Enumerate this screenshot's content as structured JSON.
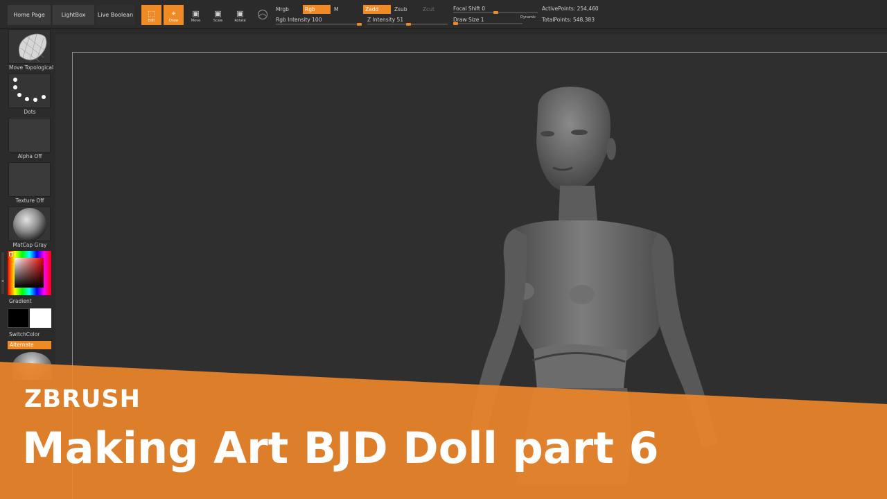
{
  "nav": {
    "home_page": "Home Page",
    "lightbox": "LightBox",
    "live_boolean": "Live Boolean"
  },
  "tools": {
    "edit": "Edit",
    "draw": "Draw",
    "move": "Move",
    "scale": "Scale",
    "rotate": "Rotate"
  },
  "modes": {
    "mrgb": "Mrgb",
    "rgb": "Rgb",
    "m": "M",
    "zadd": "Zadd",
    "zsub": "Zsub",
    "zcut": "Zcut"
  },
  "params": {
    "rgb_intensity": "Rgb Intensity 100",
    "z_intensity": "Z Intensity 51",
    "focal_shift": "Focal Shift 0",
    "draw_size": "Draw Size 1",
    "dynamic": "Dynamic",
    "rgb_intensity_value": 100,
    "z_intensity_value": 51,
    "focal_shift_value": 0,
    "draw_size_value": 1
  },
  "stats": {
    "active_points": "ActivePoints: 254,460",
    "total_points": "TotalPoints: 548,383"
  },
  "shelf": {
    "brush": "Move Topological",
    "stroke": "Dots",
    "alpha": "Alpha Off",
    "texture": "Texture Off",
    "material": "MatCap Gray",
    "gradient": "Gradient",
    "switch_color": "SwitchColor",
    "alternate": "Alternate"
  },
  "banner": {
    "subtitle": "ZBRUSH",
    "title": "Making Art BJD Doll part 6"
  },
  "colors": {
    "accent": "#f08a24",
    "banner": "#e9842a",
    "ui_bg": "#2b2b2b",
    "viewport_bg": "#2f2f2f"
  }
}
